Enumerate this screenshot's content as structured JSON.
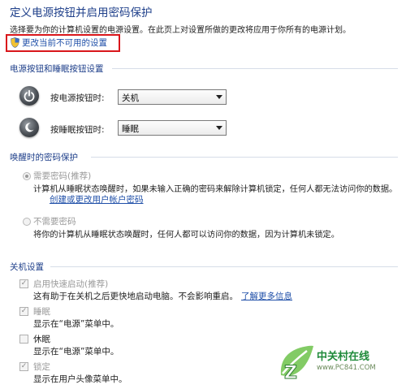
{
  "page": {
    "title": "定义电源按钮并启用密码保护",
    "description": "选择要为你的计算机设置的电源设置。在此页上对设置所做的更改将应用于你所有的电源计划。",
    "change_link": "更改当前不可用的设置"
  },
  "power_section": {
    "heading": "电源按钮和睡眠按钮设置",
    "power_button_label": "按电源按钮时:",
    "power_button_value": "关机",
    "sleep_button_label": "按睡眠按钮时:",
    "sleep_button_value": "睡眠"
  },
  "wake_section": {
    "heading": "唤醒时的密码保护",
    "require_label": "需要密码(推荐)",
    "require_desc": "计算机从睡眠状态唤醒时，如果未输入正确的密码来解除计算机锁定，任何人都无法访问你的数据。",
    "create_link": "创建或更改用户帐户密码",
    "no_require_label": "不需要密码",
    "no_require_desc": "将你的计算机从睡眠状态唤醒时，任何人都可以访问你的数据，因为计算机未锁定。"
  },
  "shutdown_section": {
    "heading": "关机设置",
    "fast_startup_label": "启用快速启动(推荐)",
    "fast_startup_desc": "这有助于在关机之后更快地启动电脑。不会影响重启。",
    "learn_more": "了解更多信息",
    "sleep_label": "睡眠",
    "sleep_desc": "显示在“电源”菜单中。",
    "hibernate_label": "休眠",
    "hibernate_desc": "显示在“电源”菜单中。",
    "lock_label": "锁定",
    "lock_desc": "显示在用户头像菜单中。"
  },
  "watermark": {
    "cn": "中关村在线",
    "url": "www.PC841.COM"
  },
  "colors": {
    "heading": "#1e3f8a",
    "link": "#1f4fa8",
    "highlight_box": "#d9161b"
  }
}
